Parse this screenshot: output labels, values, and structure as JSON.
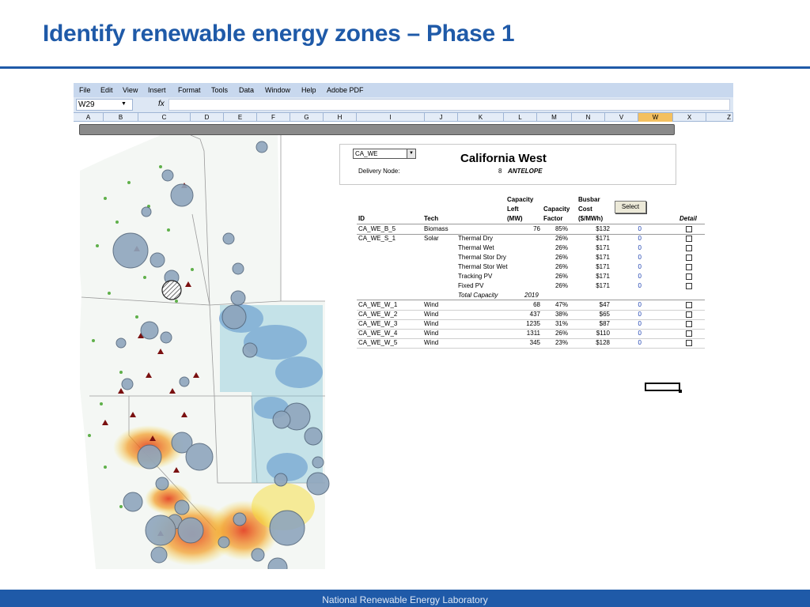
{
  "slide": {
    "title": "Identify renewable energy zones – Phase 1",
    "footer": "National Renewable Energy Laboratory"
  },
  "excel": {
    "menu": [
      "File",
      "Edit",
      "View",
      "Insert",
      "Format",
      "Tools",
      "Data",
      "Window",
      "Help",
      "Adobe PDF"
    ],
    "name_box": "W29",
    "fx_label": "fx",
    "columns": [
      "A",
      "B",
      "C",
      "D",
      "E",
      "F",
      "G",
      "H",
      "I",
      "J",
      "K",
      "L",
      "M",
      "N",
      "V",
      "W",
      "X",
      "Z"
    ],
    "active_column": "W"
  },
  "zone": {
    "select_value": "CA_WE",
    "title": "California West",
    "delivery_label": "Delivery Node:",
    "delivery_number": "8",
    "delivery_name": "ANTELOPE",
    "select_button": "Select"
  },
  "table": {
    "headers": {
      "id": "ID",
      "tech": "Tech",
      "cap_left_1": "Capacity",
      "cap_left_2": "Left",
      "cap_left_3": "(MW)",
      "cap_factor_1": "Capacity",
      "cap_factor_2": "Factor",
      "busbar_1": "Busbar",
      "busbar_2": "Cost",
      "busbar_3": "($/MWh)",
      "detail": "Detail"
    },
    "rows": [
      {
        "id": "CA_WE_B_5",
        "tech": "Biomass",
        "sub": "",
        "cap": "76",
        "cf": "85%",
        "cost": "$132",
        "sel": "0"
      },
      {
        "id": "CA_WE_S_1",
        "tech": "Solar",
        "sub": "Thermal Dry",
        "cap": "",
        "cf": "26%",
        "cost": "$171",
        "sel": "0"
      },
      {
        "id": "",
        "tech": "",
        "sub": "Thermal Wet",
        "cap": "",
        "cf": "26%",
        "cost": "$171",
        "sel": "0"
      },
      {
        "id": "",
        "tech": "",
        "sub": "Thermal Stor Dry",
        "cap": "",
        "cf": "26%",
        "cost": "$171",
        "sel": "0"
      },
      {
        "id": "",
        "tech": "",
        "sub": "Thermal Stor Wet",
        "cap": "",
        "cf": "26%",
        "cost": "$171",
        "sel": "0"
      },
      {
        "id": "",
        "tech": "",
        "sub": "Tracking PV",
        "cap": "",
        "cf": "26%",
        "cost": "$171",
        "sel": "0"
      },
      {
        "id": "",
        "tech": "",
        "sub": "Fixed PV",
        "cap": "",
        "cf": "26%",
        "cost": "$171",
        "sel": "0"
      }
    ],
    "total_label": "Total Capacity",
    "total_value": "2019",
    "wind_rows": [
      {
        "id": "CA_WE_W_1",
        "tech": "Wind",
        "cap": "68",
        "cf": "47%",
        "cost": "$47",
        "sel": "0"
      },
      {
        "id": "CA_WE_W_2",
        "tech": "Wind",
        "cap": "437",
        "cf": "38%",
        "cost": "$65",
        "sel": "0"
      },
      {
        "id": "CA_WE_W_3",
        "tech": "Wind",
        "cap": "1235",
        "cf": "31%",
        "cost": "$87",
        "sel": "0"
      },
      {
        "id": "CA_WE_W_4",
        "tech": "Wind",
        "cap": "1311",
        "cf": "26%",
        "cost": "$110",
        "sel": "0"
      },
      {
        "id": "CA_WE_W_5",
        "tech": "Wind",
        "cap": "345",
        "cf": "23%",
        "cost": "$128",
        "sel": "0"
      }
    ]
  },
  "colors": {
    "slide_blue": "#1f5aa8",
    "menubar": "#c8d8ee",
    "active_column": "#f4c060",
    "zone_bubble": "#8fa6bd",
    "site_triangle": "#7a1010"
  }
}
